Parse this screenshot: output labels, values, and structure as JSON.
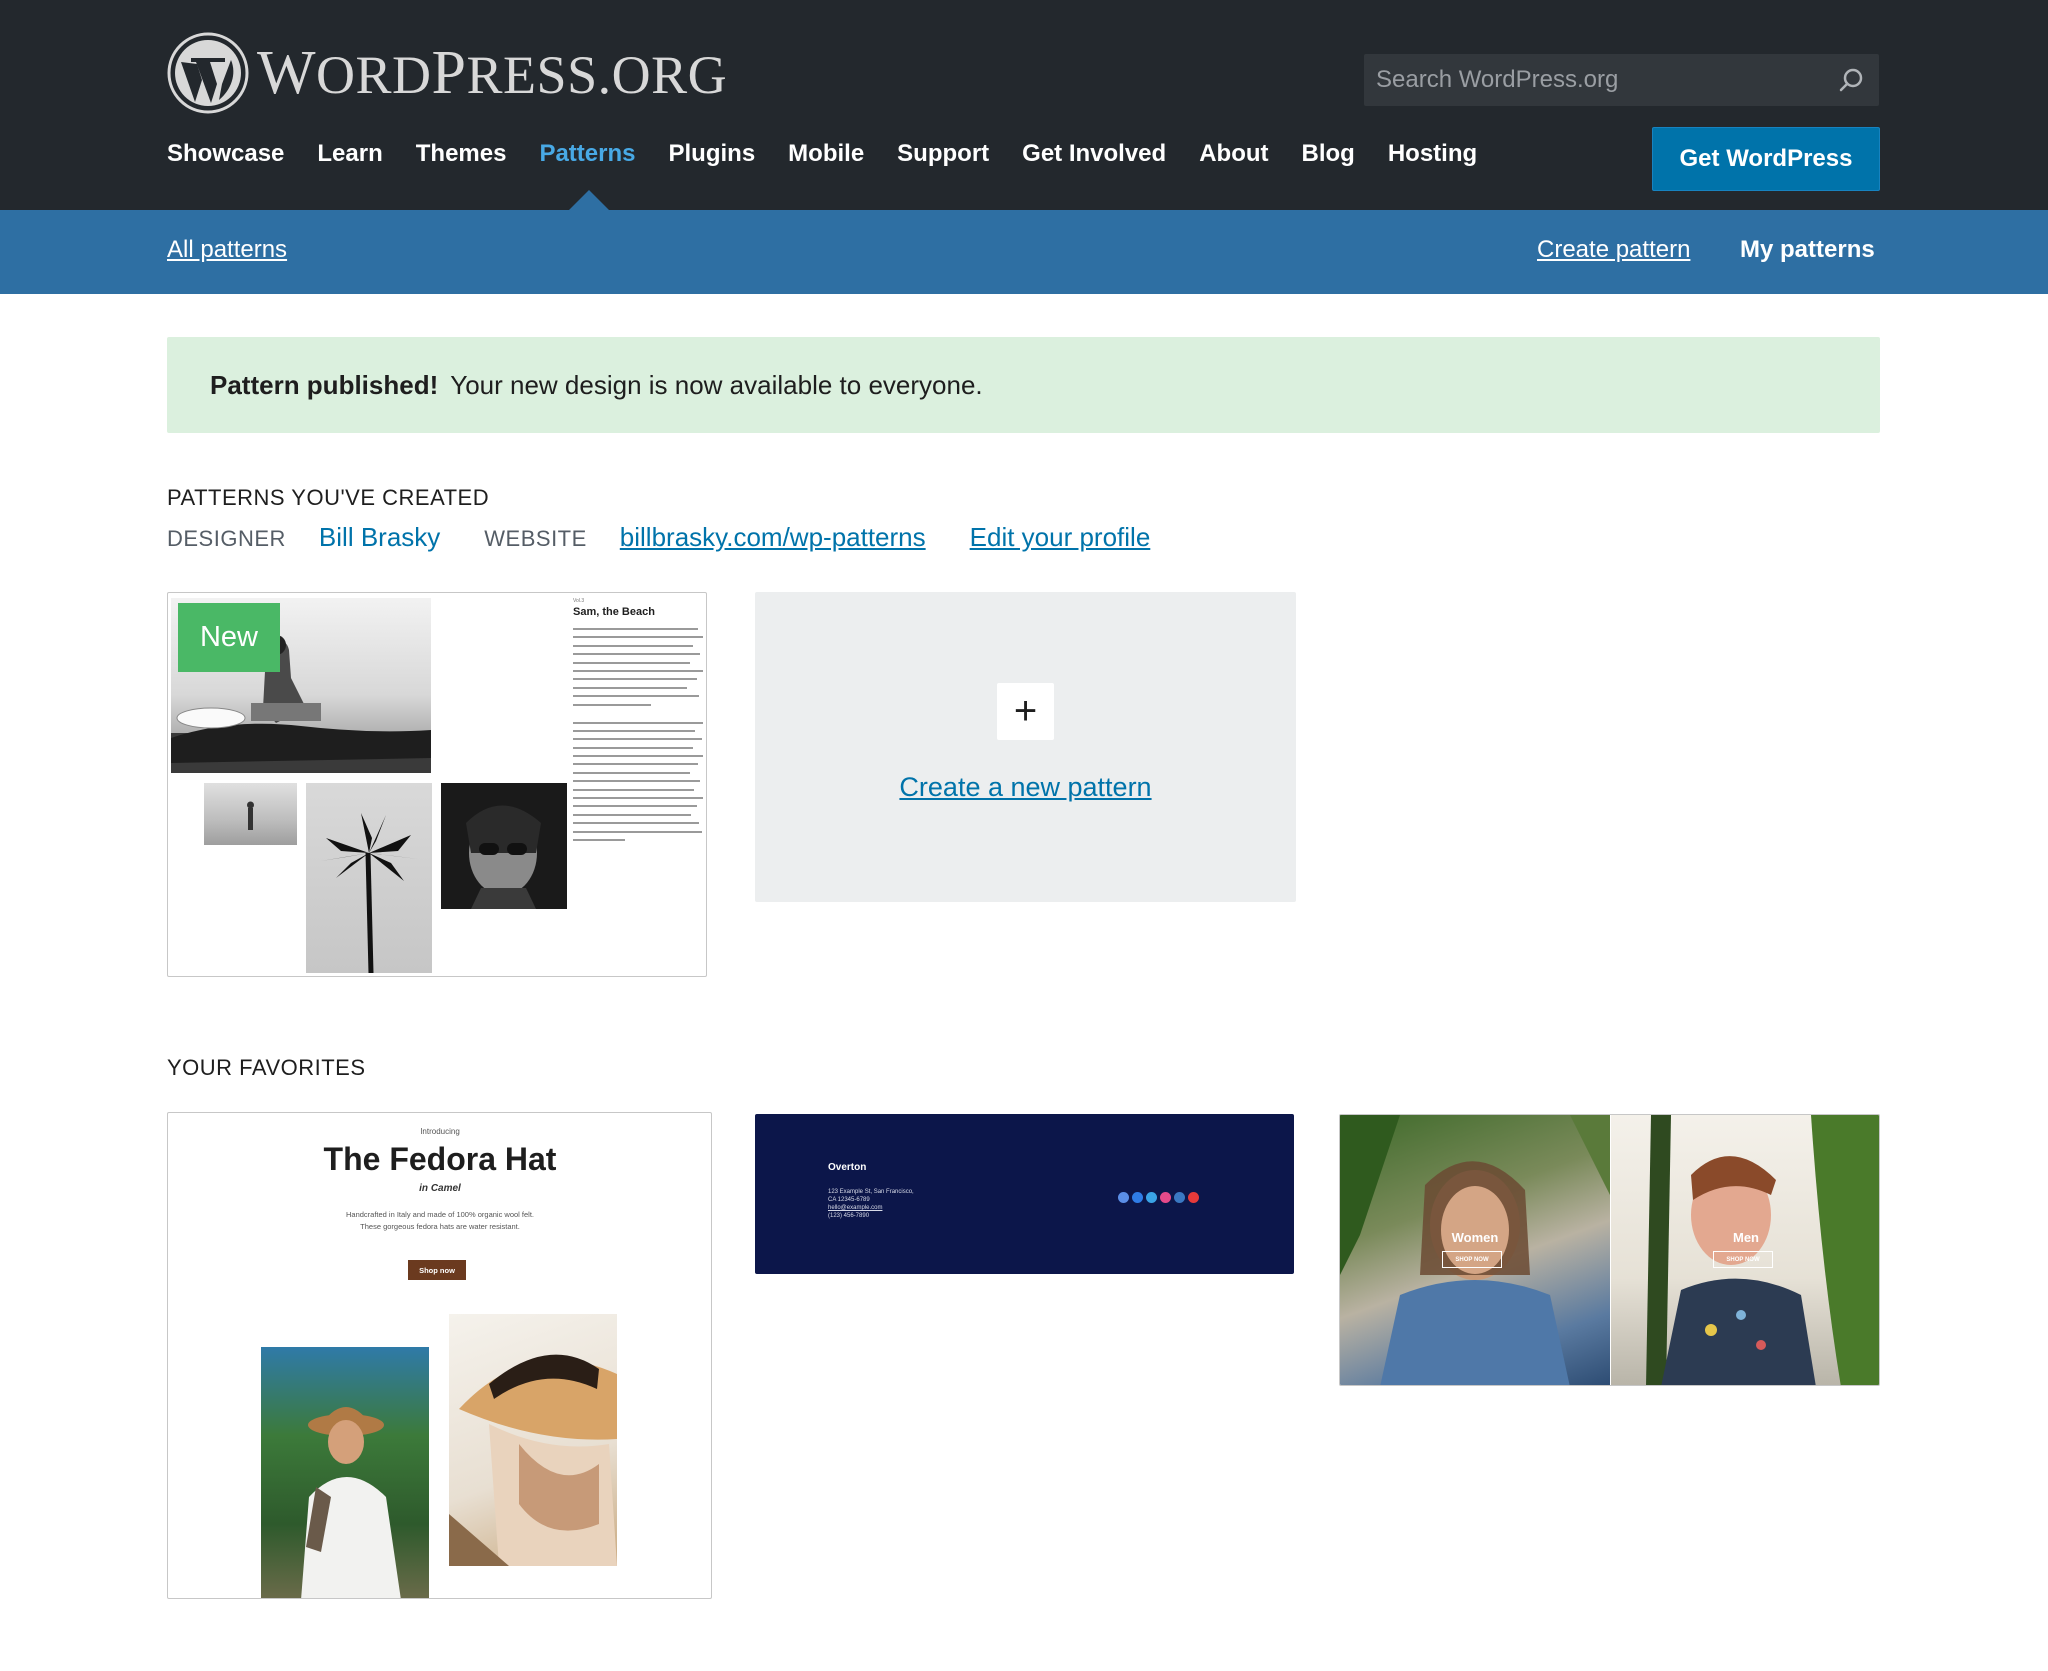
{
  "header": {
    "logo_text_first": "W",
    "logo_text_rest": "ORD",
    "logo_text_p": "P",
    "logo_text_ress": "RESS",
    "logo_text_org": ".ORG",
    "search_placeholder": "Search WordPress.org",
    "nav": [
      {
        "label": "Showcase"
      },
      {
        "label": "Learn"
      },
      {
        "label": "Themes"
      },
      {
        "label": "Patterns"
      },
      {
        "label": "Plugins"
      },
      {
        "label": "Mobile"
      },
      {
        "label": "Support"
      },
      {
        "label": "Get Involved"
      },
      {
        "label": "About"
      },
      {
        "label": "Blog"
      },
      {
        "label": "Hosting"
      }
    ],
    "active_nav": "Patterns",
    "cta_label": "Get WordPress"
  },
  "subnav": {
    "all_patterns": "All patterns",
    "create_pattern": "Create pattern",
    "my_patterns": "My patterns"
  },
  "notice": {
    "strong": "Pattern published!",
    "text": "Your new design is now available to everyone."
  },
  "created": {
    "heading": "PATTERNS YOU'VE CREATED",
    "designer_label": "DESIGNER",
    "designer_name": "Bill Brasky",
    "website_label": "WEBSITE",
    "website_url": "billbrasky.com/wp-patterns",
    "edit_profile": "Edit your profile",
    "new_badge": "New",
    "pattern_preview": {
      "kicker": "Vol.3",
      "title": "Sam, the Beach"
    },
    "create_new": "Create a new pattern",
    "plus": "+"
  },
  "favorites": {
    "heading": "YOUR FAVORITES",
    "fedora": {
      "intro": "Introducing",
      "title": "The Fedora Hat",
      "subtitle": "in Camel",
      "description": "Handcrafted in Italy and made of 100% organic wool felt. These gorgeous fedora hats are water resistant.",
      "button": "Shop now"
    },
    "footer": {
      "name": "Overton",
      "address": "123 Example St, San Francisco, CA 12345-6789",
      "email": "hello@example.com",
      "phone": "(123) 456-7890"
    },
    "split": {
      "women": "Women",
      "men": "Men",
      "shop_now": "SHOP NOW"
    }
  },
  "colors": {
    "header_bg": "#23282d",
    "subnav_bg": "#2e6fa3",
    "accent": "#0073aa",
    "active_nav": "#48a9e5",
    "notice_bg": "#dbf0de",
    "badge_green": "#4ab866"
  }
}
